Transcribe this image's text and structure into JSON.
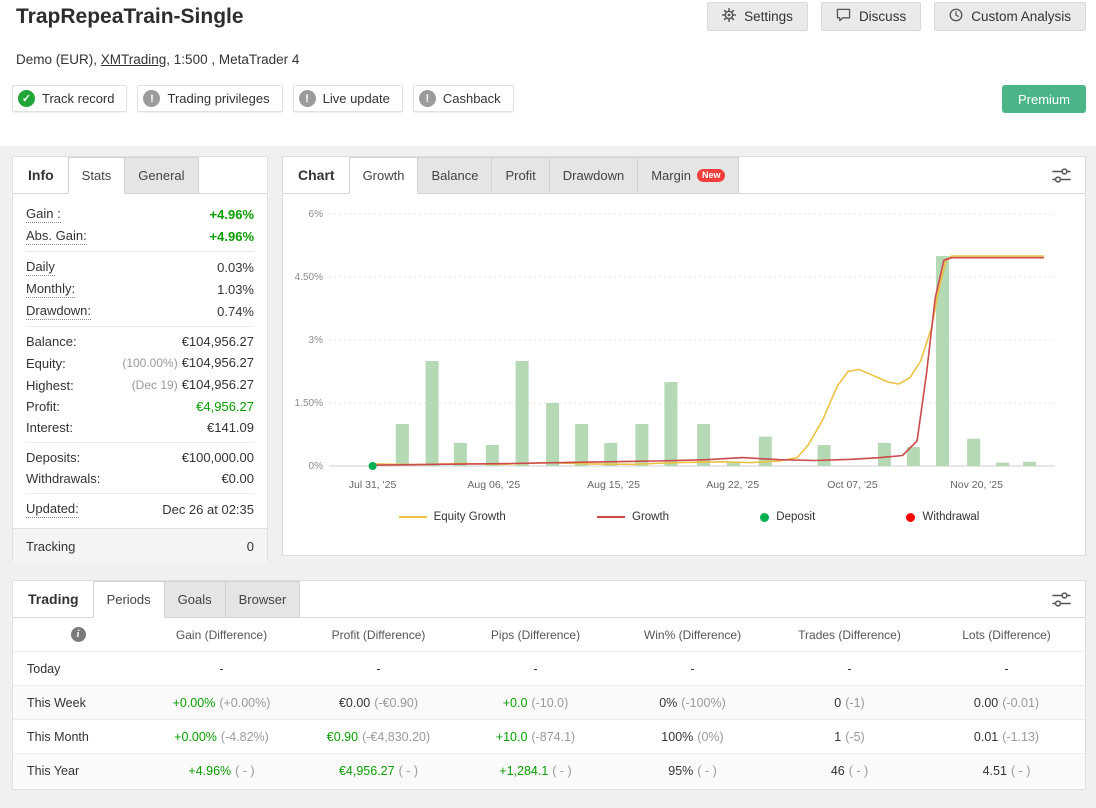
{
  "colors": {
    "green": "#089e01",
    "bar_green": "#b5d8b5",
    "equity_line": "#edc240",
    "growth_line": "#cb4b4b",
    "deposit_dot": "#00b050",
    "withdrawal_dot": "#ff0000",
    "premium_bg": "#4cb588",
    "new_badge": "#f03e3e"
  },
  "header": {
    "title": "TrapRepeaTrain-Single",
    "subtitle_pre": "Demo (EUR), ",
    "subtitle_link": "XMTrading",
    "subtitle_post": ", 1:500 , MetaTrader 4",
    "actions": [
      {
        "label": "Settings",
        "icon": "gear-icon"
      },
      {
        "label": "Discuss",
        "icon": "chat-icon"
      },
      {
        "label": "Custom Analysis",
        "icon": "clock-icon"
      }
    ],
    "badges": [
      {
        "label": "Track record",
        "status": "ok"
      },
      {
        "label": "Trading privileges",
        "status": "info"
      },
      {
        "label": "Live update",
        "status": "info"
      },
      {
        "label": "Cashback",
        "status": "info"
      }
    ],
    "premium": "Premium"
  },
  "info_panel": {
    "title": "Info",
    "tabs": [
      {
        "label": "Stats"
      },
      {
        "label": "General"
      }
    ],
    "active_tab": "Stats",
    "groups": [
      [
        {
          "label": "Gain :",
          "value": "+4.96%",
          "green": true,
          "bold": true,
          "dotted": true
        },
        {
          "label": "Abs. Gain:",
          "value": "+4.96%",
          "green": true,
          "bold": true,
          "dotted": true
        }
      ],
      [
        {
          "label": "Daily",
          "value": "0.03%",
          "dotted": true
        },
        {
          "label": "Monthly:",
          "value": "1.03%",
          "dotted": true
        },
        {
          "label": "Drawdown:",
          "value": "0.74%",
          "dotted": true
        }
      ],
      [
        {
          "label": "Balance:",
          "value": "€104,956.27"
        },
        {
          "label": "Equity:",
          "pre": "(100.00%)",
          "value": "€104,956.27"
        },
        {
          "label": "Highest:",
          "pre": "(Dec 19)",
          "value": "€104,956.27"
        },
        {
          "label": "Profit:",
          "value": "€4,956.27",
          "green": true
        },
        {
          "label": "Interest:",
          "value": "€141.09"
        }
      ],
      [
        {
          "label": "Deposits:",
          "value": "€100,000.00"
        },
        {
          "label": "Withdrawals:",
          "value": "€0.00"
        }
      ],
      [
        {
          "label": "Updated:",
          "value": "Dec 26 at 02:35",
          "dotted": true
        }
      ],
      [
        {
          "label": "Tracking",
          "value": "0",
          "shaded": true
        }
      ]
    ]
  },
  "chart_panel": {
    "title": "Chart",
    "tabs": [
      {
        "label": "Growth"
      },
      {
        "label": "Balance"
      },
      {
        "label": "Profit"
      },
      {
        "label": "Drawdown"
      },
      {
        "label": "Margin",
        "badge": "New"
      }
    ],
    "active_tab": "Growth"
  },
  "chart_data": {
    "type": "bar+line",
    "title": "Growth chart",
    "ylim": [
      0,
      6
    ],
    "y_ticks": [
      {
        "v": 0,
        "label": "0%"
      },
      {
        "v": 1.5,
        "label": "1.50%"
      },
      {
        "v": 3,
        "label": "3%"
      },
      {
        "v": 4.5,
        "label": "4.50%"
      },
      {
        "v": 6,
        "label": "6%"
      }
    ],
    "x_ticks": [
      {
        "f": 0.06,
        "label": "Jul 31, '25"
      },
      {
        "f": 0.227,
        "label": "Aug 06, '25"
      },
      {
        "f": 0.392,
        "label": "Aug 15, '25"
      },
      {
        "f": 0.556,
        "label": "Aug 22, '25"
      },
      {
        "f": 0.721,
        "label": "Oct 07, '25"
      },
      {
        "f": 0.892,
        "label": "Nov 20, '25"
      }
    ],
    "bars": [
      [
        0.101,
        1.0
      ],
      [
        0.142,
        2.5
      ],
      [
        0.181,
        0.55
      ],
      [
        0.225,
        0.5
      ],
      [
        0.266,
        2.5
      ],
      [
        0.308,
        1.5
      ],
      [
        0.348,
        1.0
      ],
      [
        0.388,
        0.55
      ],
      [
        0.431,
        1.0
      ],
      [
        0.471,
        2.0
      ],
      [
        0.516,
        1.0
      ],
      [
        0.557,
        0.1
      ],
      [
        0.601,
        0.7
      ],
      [
        0.682,
        0.5
      ],
      [
        0.765,
        0.55
      ],
      [
        0.805,
        0.45
      ],
      [
        0.845,
        5.0
      ],
      [
        0.888,
        0.65
      ],
      [
        0.928,
        0.08
      ],
      [
        0.965,
        0.1
      ]
    ],
    "series": [
      {
        "name": "Equity Growth",
        "color_key": "equity_line",
        "points": [
          [
            0.06,
            0.05
          ],
          [
            0.12,
            0.03
          ],
          [
            0.18,
            0.06
          ],
          [
            0.24,
            0.04
          ],
          [
            0.3,
            0.08
          ],
          [
            0.36,
            0.05
          ],
          [
            0.42,
            0.04
          ],
          [
            0.48,
            0.08
          ],
          [
            0.54,
            0.1
          ],
          [
            0.58,
            0.08
          ],
          [
            0.62,
            0.12
          ],
          [
            0.645,
            0.2
          ],
          [
            0.66,
            0.5
          ],
          [
            0.68,
            1.1
          ],
          [
            0.7,
            1.9
          ],
          [
            0.715,
            2.25
          ],
          [
            0.73,
            2.3
          ],
          [
            0.75,
            2.15
          ],
          [
            0.77,
            2.0
          ],
          [
            0.785,
            1.95
          ],
          [
            0.8,
            2.1
          ],
          [
            0.815,
            2.5
          ],
          [
            0.83,
            3.3
          ],
          [
            0.84,
            4.2
          ],
          [
            0.85,
            4.9
          ],
          [
            0.858,
            5.0
          ],
          [
            0.985,
            5.0
          ]
        ]
      },
      {
        "name": "Growth",
        "color_key": "growth_line",
        "points": [
          [
            0.06,
            0.02
          ],
          [
            0.15,
            0.04
          ],
          [
            0.25,
            0.06
          ],
          [
            0.35,
            0.09
          ],
          [
            0.45,
            0.12
          ],
          [
            0.52,
            0.15
          ],
          [
            0.57,
            0.2
          ],
          [
            0.62,
            0.15
          ],
          [
            0.67,
            0.13
          ],
          [
            0.72,
            0.16
          ],
          [
            0.76,
            0.2
          ],
          [
            0.79,
            0.25
          ],
          [
            0.81,
            0.6
          ],
          [
            0.823,
            2.2
          ],
          [
            0.835,
            4.0
          ],
          [
            0.847,
            4.9
          ],
          [
            0.858,
            4.96
          ],
          [
            0.985,
            4.96
          ]
        ]
      }
    ],
    "markers": [
      {
        "type": "deposit",
        "f": 0.06,
        "v": 0
      }
    ],
    "legend": [
      {
        "label": "Equity Growth",
        "swatch": "line",
        "color_key": "equity_line"
      },
      {
        "label": "Growth",
        "swatch": "line",
        "color_key": "growth_line"
      },
      {
        "label": "Deposit",
        "swatch": "dot",
        "color_key": "deposit_dot"
      },
      {
        "label": "Withdrawal",
        "swatch": "dot",
        "color_key": "withdrawal_dot"
      }
    ]
  },
  "periods_panel": {
    "title": "Trading",
    "tabs": [
      {
        "label": "Periods"
      },
      {
        "label": "Goals"
      },
      {
        "label": "Browser"
      }
    ],
    "active_tab": "Periods",
    "columns": [
      "Gain (Difference)",
      "Profit (Difference)",
      "Pips (Difference)",
      "Win% (Difference)",
      "Trades (Difference)",
      "Lots (Difference)"
    ],
    "rows": [
      {
        "label": "Today",
        "cells": [
          {
            "main": "-"
          },
          {
            "main": "-"
          },
          {
            "main": "-"
          },
          {
            "main": "-"
          },
          {
            "main": "-"
          },
          {
            "main": "-"
          }
        ]
      },
      {
        "label": "This Week",
        "cells": [
          {
            "main": "+0.00%",
            "diff": "(+0.00%)",
            "green": true
          },
          {
            "main": "€0.00",
            "diff": "(-€0.90)"
          },
          {
            "main": "+0.0",
            "diff": "(-10.0)",
            "green": true
          },
          {
            "main": "0%",
            "diff": "(-100%)"
          },
          {
            "main": "0",
            "diff": "(-1)"
          },
          {
            "main": "0.00",
            "diff": "(-0.01)"
          }
        ]
      },
      {
        "label": "This Month",
        "cells": [
          {
            "main": "+0.00%",
            "diff": "(-4.82%)",
            "green": true
          },
          {
            "main": "€0.90",
            "diff": "(-€4,830.20)",
            "green": true
          },
          {
            "main": "+10.0",
            "diff": "(-874.1)",
            "green": true
          },
          {
            "main": "100%",
            "diff": "(0%)"
          },
          {
            "main": "1",
            "diff": "(-5)"
          },
          {
            "main": "0.01",
            "diff": "(-1.13)"
          }
        ]
      },
      {
        "label": "This Year",
        "cells": [
          {
            "main": "+4.96%",
            "diff": "( - )",
            "green": true
          },
          {
            "main": "€4,956.27",
            "diff": "( - )",
            "green": true
          },
          {
            "main": "+1,284.1",
            "diff": "( - )",
            "green": true
          },
          {
            "main": "95%",
            "diff": "( - )"
          },
          {
            "main": "46",
            "diff": "( - )"
          },
          {
            "main": "4.51",
            "diff": "( - )"
          }
        ]
      }
    ]
  }
}
